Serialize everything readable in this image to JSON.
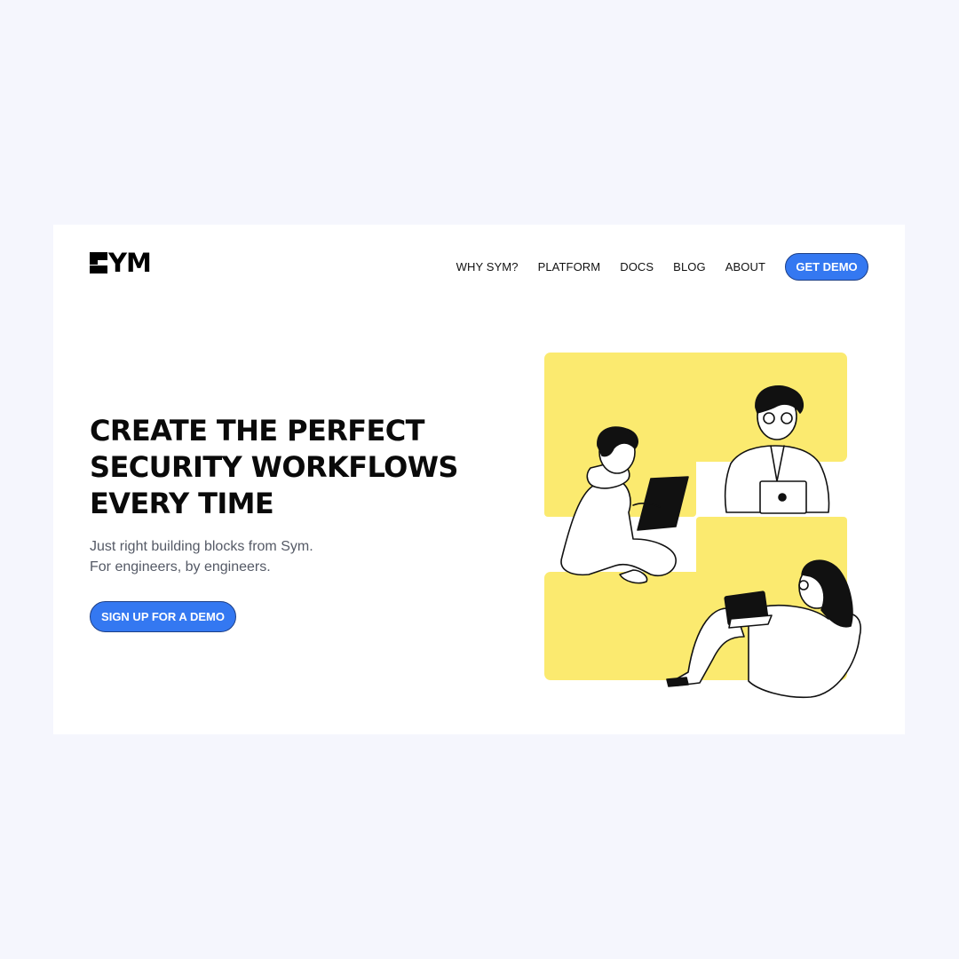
{
  "brand": {
    "name": "SYM",
    "logo_text": "YM"
  },
  "nav": {
    "links": [
      "WHY SYM?",
      "PLATFORM",
      "DOCS",
      "BLOG",
      "ABOUT"
    ],
    "cta_label": "GET DEMO"
  },
  "hero": {
    "headline_lines": [
      "CREATE THE PERFECT",
      "SECURITY WORKFLOWS",
      "EVERY TIME"
    ],
    "subtext_lines": [
      "Just right building blocks from Sym.",
      "For engineers, by engineers."
    ],
    "cta_label": "SIGN UP FOR A DEMO"
  },
  "colors": {
    "page_background": "#f5f6fd",
    "card_background": "#ffffff",
    "accent": "#3478f1",
    "illustration_yellow": "#fbea6f",
    "text": "#0a0a0a"
  },
  "icons": [
    "sym-logo-icon",
    "engineers-illustration"
  ]
}
